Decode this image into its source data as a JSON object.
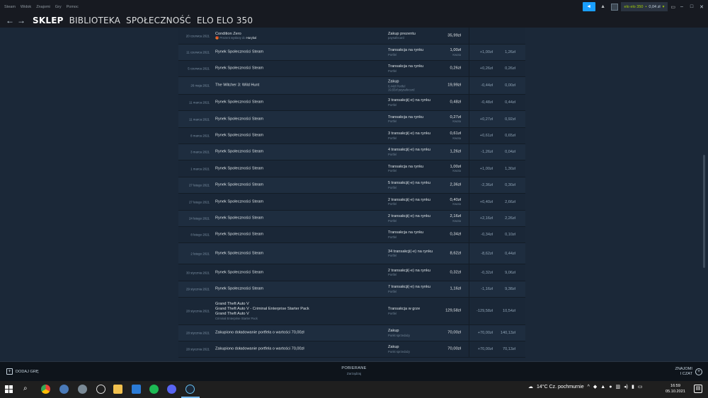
{
  "menu": [
    "Steam",
    "Widok",
    "Znajomi",
    "Gry",
    "Pomoc"
  ],
  "account": {
    "name": "elo elo 350",
    "wallet": "0,04 zł"
  },
  "nav": {
    "tabs": [
      "SKLEP",
      "BIBLIOTEKA",
      "SPOŁECZNOŚĆ",
      "ELO ELO 350"
    ],
    "back": "←",
    "forward": "→"
  },
  "transactions": [
    {
      "date": "20 czerwca 2021",
      "items": [
        "Condition Zero"
      ],
      "note": "Prezent wysłany do",
      "note_name": "Harybal",
      "type": "Zakup prezentu",
      "type_sub": "paysafecard",
      "total": "35,99zł",
      "total_sub": "",
      "change": "",
      "balance": ""
    },
    {
      "date": "11 czerwca 2021",
      "items": [
        "Rynek Społeczności Steam"
      ],
      "type": "Transakcja na rynku",
      "type_sub": "Portfel",
      "total": "1,00zł",
      "total_sub": "Kwota",
      "change": "+1,00zł",
      "balance": "1,26zł"
    },
    {
      "date": "5 czerwca 2021",
      "items": [
        "Rynek Społeczności Steam"
      ],
      "type": "Transakcja na rynku",
      "type_sub": "Portfel",
      "total": "0,26zł",
      "total_sub": "",
      "change": "+0,26zł",
      "balance": "0,26zł"
    },
    {
      "date": "26 maja 2021",
      "items": [
        "The Witcher 3: Wild Hunt"
      ],
      "type": "Zakup",
      "type_sub": "0,44zł Portfel",
      "type_sub2": "19,55zł paysafecard",
      "total": "19,99zł",
      "total_sub": "",
      "change": "-0,44zł",
      "balance": "0,00zł"
    },
    {
      "date": "11 marca 2021",
      "items": [
        "Rynek Społeczności Steam"
      ],
      "type": "3 transakcji(-e) na rynku",
      "type_sub": "Portfel",
      "total": "0,48zł",
      "total_sub": "",
      "change": "-0,48zł",
      "balance": "0,44zł"
    },
    {
      "date": "11 marca 2021",
      "items": [
        "Rynek Społeczności Steam"
      ],
      "type": "Transakcja na rynku",
      "type_sub": "Portfel",
      "total": "0,27zł",
      "total_sub": "Kwota",
      "change": "+0,27zł",
      "balance": "0,92zł"
    },
    {
      "date": "8 marca 2021",
      "items": [
        "Rynek Społeczności Steam"
      ],
      "type": "3 transakcji(-e) na rynku",
      "type_sub": "Portfel",
      "total": "0,61zł",
      "total_sub": "Kwota",
      "change": "+0,61zł",
      "balance": "0,65zł"
    },
    {
      "date": "3 marca 2021",
      "items": [
        "Rynek Społeczności Steam"
      ],
      "type": "4 transakcji(-e) na rynku",
      "type_sub": "Portfel",
      "total": "1,26zł",
      "total_sub": "",
      "change": "-1,26zł",
      "balance": "0,04zł"
    },
    {
      "date": "1 marca 2021",
      "items": [
        "Rynek Społeczności Steam"
      ],
      "type": "Transakcja na rynku",
      "type_sub": "Portfel",
      "total": "1,00zł",
      "total_sub": "Kwota",
      "change": "+1,00zł",
      "balance": "1,30zł"
    },
    {
      "date": "27 lutego 2021",
      "items": [
        "Rynek Społeczności Steam"
      ],
      "type": "5 transakcji(-e) na rynku",
      "type_sub": "Portfel",
      "total": "2,36zł",
      "total_sub": "",
      "change": "-2,36zł",
      "balance": "0,30zł"
    },
    {
      "date": "27 lutego 2021",
      "items": [
        "Rynek Społeczności Steam"
      ],
      "type": "2 transakcji(-e) na rynku",
      "type_sub": "Portfel",
      "total": "0,40zł",
      "total_sub": "Kwota",
      "change": "+0,40zł",
      "balance": "2,66zł"
    },
    {
      "date": "24 lutego 2021",
      "items": [
        "Rynek Społeczności Steam"
      ],
      "type": "2 transakcji(-e) na rynku",
      "type_sub": "Portfel",
      "total": "2,16zł",
      "total_sub": "Kwota",
      "change": "+2,16zł",
      "balance": "2,26zł"
    },
    {
      "date": "8 lutego 2021",
      "items": [
        "Rynek Społeczności Steam"
      ],
      "type": "Transakcja na rynku",
      "type_sub": "Portfel",
      "total": "0,34zł",
      "total_sub": "",
      "change": "-0,34zł",
      "balance": "0,10zł"
    },
    {
      "date": "2 lutego 2021",
      "items": [
        "Rynek Społeczności Steam"
      ],
      "type": "34 transakcji(-e) na rynku",
      "type_sub": "Portfel",
      "total": "8,62zł",
      "total_sub": "",
      "change": "-8,62zł",
      "balance": "0,44zł"
    },
    {
      "date": "30 stycznia 2021",
      "items": [
        "Rynek Społeczności Steam"
      ],
      "type": "2 transakcji(-e) na rynku",
      "type_sub": "Portfel",
      "total": "0,32zł",
      "total_sub": "",
      "change": "-0,32zł",
      "balance": "9,06zł"
    },
    {
      "date": "29 stycznia 2021",
      "items": [
        "Rynek Społeczności Steam"
      ],
      "type": "7 transakcji(-e) na rynku",
      "type_sub": "Portfel",
      "total": "1,16zł",
      "total_sub": "",
      "change": "-1,16zł",
      "balance": "9,38zł"
    },
    {
      "date": "28 stycznia 2021",
      "items": [
        "Grand Theft Auto V",
        "Grand Theft Auto V - Criminal Enterprise Starter Pack",
        "Grand Theft Auto V"
      ],
      "note_plain": "Criminal Enterprise Starter Pack",
      "type": "Transakcja w grze",
      "type_sub": "Portfel",
      "total": "129,58zł",
      "total_sub": "",
      "change": "-129,58zł",
      "balance": "10,54zł"
    },
    {
      "date": "28 stycznia 2021",
      "items": [
        "Zakupiono doładowanie portfela o wartości 70,00zł"
      ],
      "type": "Zakup",
      "type_sub": "Punkt sprzedaży",
      "total": "70,00zł",
      "total_sub": "",
      "change": "+70,00zł",
      "balance": "140,13zł"
    },
    {
      "date": "28 stycznia 2021",
      "items": [
        "Zakupiono doładowanie portfela o wartości 70,00zł"
      ],
      "type": "Zakup",
      "type_sub": "Punkt sprzedaży",
      "total": "70,00zł",
      "total_sub": "",
      "change": "+70,00zł",
      "balance": "70,13zł"
    }
  ],
  "bottombar": {
    "add_game": "DODAJ GRĘ",
    "downloads_title": "POBIERANE",
    "downloads_status": "Zarządzaj",
    "friends_line1": "ZNAJOMI",
    "friends_line2": "I CZAT"
  },
  "taskbar": {
    "weather": "14°C  Cz. pochmurnie",
    "time": "16:59",
    "date": "05.10.2021"
  }
}
